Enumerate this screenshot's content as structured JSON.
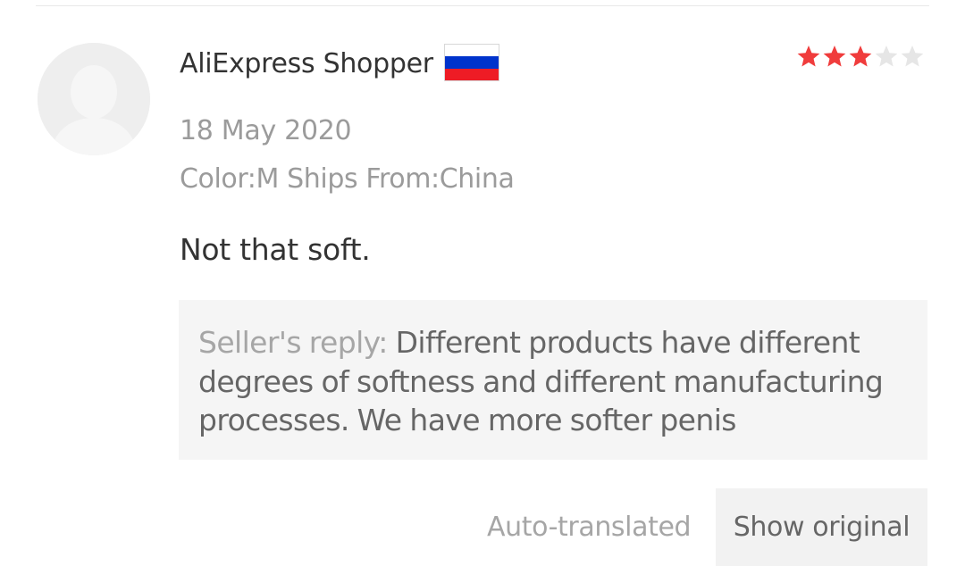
{
  "review": {
    "username": "AliExpress Shopper",
    "country_flag": {
      "icon": "russia-flag-icon",
      "colors": [
        "#ffffff",
        "#0033cc",
        "#ee1c25"
      ]
    },
    "rating": {
      "value": 3,
      "max": 5,
      "filled_color": "#f03c3c",
      "empty_color": "#e6e6e6"
    },
    "date": "18 May 2020",
    "sku": "Color:M Ships From:China",
    "text": "Not that soft.",
    "seller_reply": {
      "label": "Seller's reply:",
      "text": "Different products have different degrees of softness and different manufacturing processes. We have more softer penis"
    },
    "auto_translated": "Auto-translated",
    "show_original": "Show original"
  },
  "avatar": {
    "icon": "default-avatar-icon"
  }
}
